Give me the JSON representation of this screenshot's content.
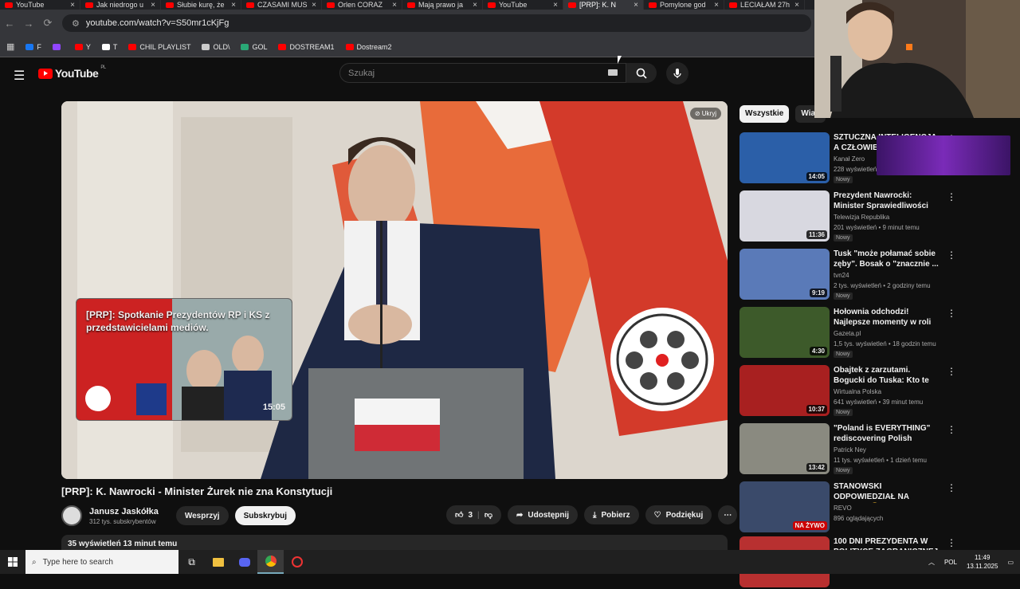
{
  "browser": {
    "tabs": [
      {
        "title": "YouTube",
        "active": false
      },
      {
        "title": "Jak niedrogo u",
        "active": false
      },
      {
        "title": "Słubie kurę, że",
        "active": false
      },
      {
        "title": "CZASAMI MUS",
        "active": false
      },
      {
        "title": "Orlen CORAZ",
        "active": false
      },
      {
        "title": "Mają prawo ja",
        "active": false
      },
      {
        "title": "YouTube",
        "active": false
      },
      {
        "title": "[PRP]: K. N",
        "active": true
      },
      {
        "title": "Pomylone god",
        "active": false
      },
      {
        "title": "LECIAŁAM 27h",
        "active": false
      }
    ],
    "url": "youtube.com/watch?v=S50mr1cKjFg",
    "bookmarks": [
      {
        "label": "F",
        "color": "#1877f2"
      },
      {
        "label": "",
        "color": "#9146ff"
      },
      {
        "label": "Y",
        "color": "#ff0000"
      },
      {
        "label": "T",
        "color": "#ffffff"
      },
      {
        "label": "CHIL PLAYLIST",
        "color": "#ff0000"
      },
      {
        "label": "OLD\\",
        "color": "#cccccc"
      },
      {
        "label": "GOL",
        "color": "#2aa876"
      },
      {
        "label": "DOSTREAM1",
        "color": "#ff0000"
      },
      {
        "label": "Dostream2",
        "color": "#ff0000"
      }
    ]
  },
  "header": {
    "logo_text": "YouTube",
    "region": "PL",
    "search_placeholder": "Szukaj"
  },
  "player": {
    "hide_label": "Ukryj",
    "endcard_title": "[PRP]: Spotkanie Prezydentów RP i KS z przedstawicielami mediów.",
    "endcard_duration": "15:05"
  },
  "video": {
    "title": "[PRP]: K. Nawrocki - Minister Żurek nie zna Konstytucji",
    "channel": "Janusz Jaskółka",
    "subscribers": "312 tys. subskrybentów",
    "support_label": "Wesprzyj",
    "subscribe_label": "Subskrybuj",
    "likes": "3",
    "share_label": "Udostępnij",
    "download_label": "Pobierz",
    "thanks_label": "Podziękuj",
    "description_meta": "35 wyświetleń  13 minut temu"
  },
  "chips": [
    "Wszystkie",
    "Wiad"
  ],
  "recommendations": [
    {
      "title": "SZTUCZNA INTELIGENCJA, A CZŁOWIEK. P",
      "channel": "Kanał Zero",
      "views": "228 wyświetleń",
      "badge": "Nowy",
      "duration": "14:05",
      "thumb_color": "#2b5fa8"
    },
    {
      "title": "Prezydent Nawrocki: Minister Sprawiedliwości powinien ...",
      "channel": "Telewizja Republika",
      "views": "201 wyświetleń • 9 minut temu",
      "badge": "Nowy",
      "duration": "11:36",
      "thumb_color": "#d8d8e0"
    },
    {
      "title": "Tusk \"może połamać sobie zęby\". Bosak o \"znacznie ...",
      "channel": "tvn24",
      "views": "2 tys. wyświetleń • 2 godziny temu",
      "badge": "Nowy",
      "duration": "9:19",
      "thumb_color": "#5a7ab8"
    },
    {
      "title": "Hołownia odchodzi! Najlepsze momenty w roli marszałka ...",
      "channel": "Gazeta.pl",
      "views": "1,5 tys. wyświetleń • 18 godzin temu",
      "badge": "Nowy",
      "duration": "4:30",
      "thumb_color": "#3d5a2a"
    },
    {
      "title": "Obajtek z zarzutami. Bogucki do Tuska: Kto te pieniądze ukradł?",
      "channel": "Wirtualna Polska",
      "views": "641 wyświetleń • 39 minut temu",
      "badge": "Nowy",
      "duration": "10:37",
      "thumb_color": "#a82020"
    },
    {
      "title": "\"Poland is EVERYTHING\" rediscovering Polish identity",
      "channel": "Patrick Ney",
      "views": "11 tys. wyświetleń • 1 dzień temu",
      "badge": "Nowy",
      "duration": "13:42",
      "thumb_color": "#8a8a80"
    },
    {
      "title": "STANOWSKI ODPOWIEDZIAŁ NA KONOPA 😮 UOKiK vs ...",
      "channel": "REVO",
      "views": "896 oglądających",
      "badge": "",
      "duration": "NA ŻYWO",
      "thumb_color": "#3a4a6a"
    },
    {
      "title": "100 DNI PREZYDENTA W POLITYCE ZAGRANICZNEJ ...",
      "channel": "",
      "views": "",
      "badge": "",
      "duration": "",
      "thumb_color": "#b83030"
    }
  ],
  "taskbar": {
    "search_placeholder": "Type here to search",
    "language": "POL",
    "time": "11:49",
    "date": "13.11.2025"
  }
}
